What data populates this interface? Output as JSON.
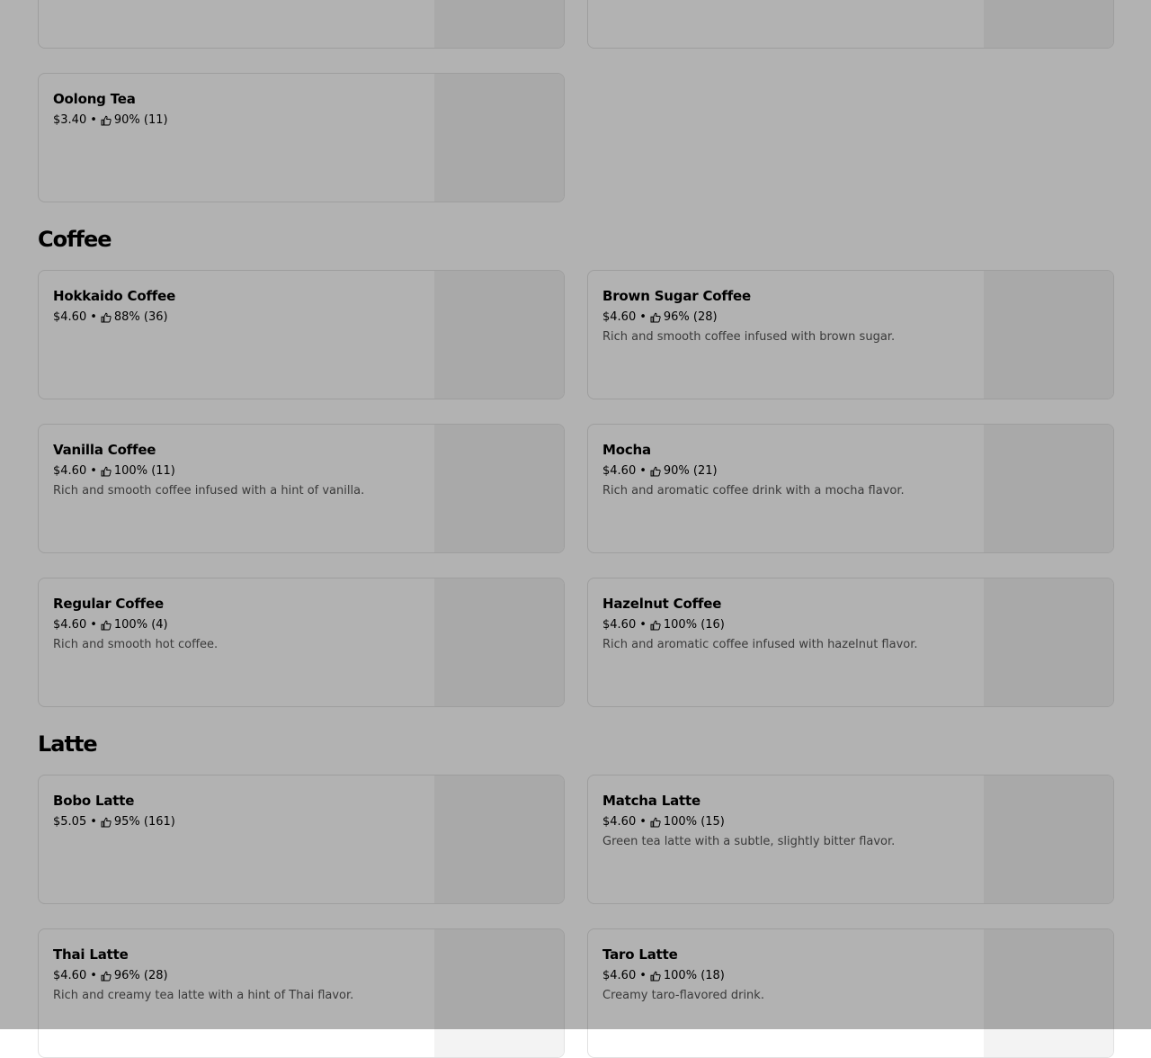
{
  "colors": {
    "text": "#000000",
    "description": "#545454",
    "card_border": "#e2e2e2",
    "image_placeholder": "#f3f3f3",
    "modal_overlay": "rgba(0,0,0,0.30)",
    "thumb_icon": "#000000"
  },
  "meta_separator": "•",
  "sections": {
    "coffee": {
      "title": "Coffee"
    },
    "latte": {
      "title": "Latte"
    }
  },
  "items": {
    "oolong_tea": {
      "name": "Oolong Tea",
      "price": "$3.40",
      "rating": "90% (11)",
      "description": ""
    },
    "hokkaido_coffee": {
      "name": "Hokkaido Coffee",
      "price": "$4.60",
      "rating": "88% (36)",
      "description": ""
    },
    "brown_sugar_coffee": {
      "name": "Brown Sugar Coffee",
      "price": "$4.60",
      "rating": "96% (28)",
      "description": "Rich and smooth coffee infused with brown sugar."
    },
    "vanilla_coffee": {
      "name": "Vanilla Coffee",
      "price": "$4.60",
      "rating": "100% (11)",
      "description": "Rich and smooth coffee infused with a hint of vanilla."
    },
    "mocha": {
      "name": "Mocha",
      "price": "$4.60",
      "rating": "90% (21)",
      "description": "Rich and aromatic coffee drink with a mocha flavor."
    },
    "regular_coffee": {
      "name": "Regular Coffee",
      "price": "$4.60",
      "rating": "100% (4)",
      "description": "Rich and smooth hot coffee."
    },
    "hazelnut_coffee": {
      "name": "Hazelnut Coffee",
      "price": "$4.60",
      "rating": "100% (16)",
      "description": "Rich and aromatic coffee infused with hazelnut flavor."
    },
    "bobo_latte": {
      "name": "Bobo Latte",
      "price": "$5.05",
      "rating": "95% (161)",
      "description": ""
    },
    "matcha_latte": {
      "name": "Matcha Latte",
      "price": "$4.60",
      "rating": "100% (15)",
      "description": "Green tea latte with a subtle, slightly bitter flavor."
    },
    "thai_latte": {
      "name": "Thai Latte",
      "price": "$4.60",
      "rating": "96% (28)",
      "description": "Rich and creamy tea latte with a hint of Thai flavor."
    },
    "taro_latte": {
      "name": "Taro Latte",
      "price": "$4.60",
      "rating": "100% (18)",
      "description": "Creamy taro-flavored drink."
    }
  }
}
